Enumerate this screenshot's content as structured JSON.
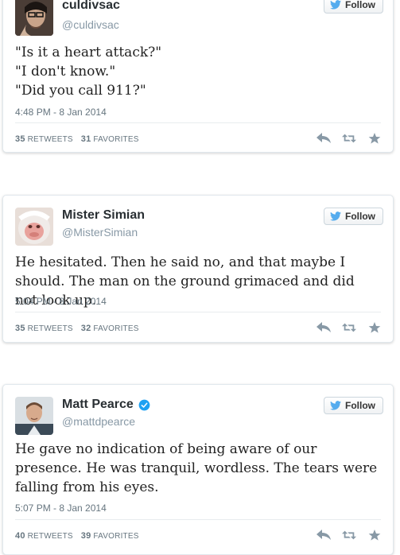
{
  "tweets": [
    {
      "display_name": "culdivsac",
      "handle": "@culdivsac",
      "text": "\"Is it a heart attack?\"\n\"I don't know.\"\n\"Did you call 911?\"",
      "timestamp": "4:48 PM - 8 Jan 2014",
      "retweets": "35",
      "retweets_label": "RETWEETS",
      "favorites": "31",
      "favorites_label": "FAVORITES",
      "follow_label": "Follow",
      "verified": false
    },
    {
      "display_name": "Mister Simian",
      "handle": "@MisterSimian",
      "text": "He hesitated. Then he said no, and that maybe I should. The man on the ground grimaced and did not look up.",
      "timestamp": "5:04 PM - 8 Jan 2014",
      "retweets": "35",
      "retweets_label": "RETWEETS",
      "favorites": "32",
      "favorites_label": "FAVORITES",
      "follow_label": "Follow",
      "verified": false
    },
    {
      "display_name": "Matt Pearce",
      "handle": "@mattdpearce",
      "text": "He gave no indication of being aware of our presence. He was tranquil, wordless. The tears were falling from his eyes.",
      "timestamp": "5:07 PM - 8 Jan 2014",
      "retweets": "40",
      "retweets_label": "RETWEETS",
      "favorites": "39",
      "favorites_label": "FAVORITES",
      "follow_label": "Follow",
      "verified": true
    }
  ],
  "icons": {
    "follow": "twitter-bird-icon",
    "reply": "reply-icon",
    "retweet": "retweet-icon",
    "favorite": "star-icon",
    "verified": "verified-badge-icon"
  },
  "colors": {
    "twitter_blue": "#55acee",
    "verified_blue": "#1da1f2",
    "action_gray": "#8899a6"
  }
}
